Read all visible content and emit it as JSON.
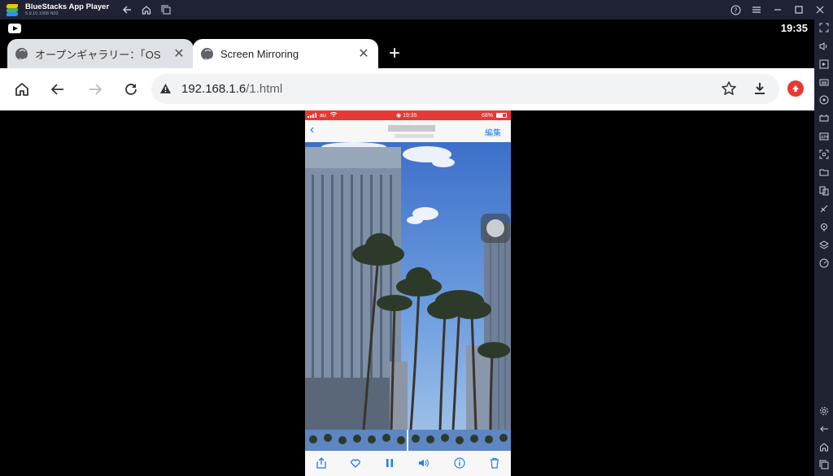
{
  "titlebar": {
    "app_name": "BlueStacks App Player",
    "version": "5.9.10.1008  N32"
  },
  "status": {
    "time": "19:35"
  },
  "tabs": [
    {
      "label": "オープンギャラリー：「OS",
      "active": false
    },
    {
      "label": "Screen Mirroring",
      "active": true
    }
  ],
  "toolbar": {
    "url_host": "192.168.1.6",
    "url_path": "/1.html"
  },
  "phone": {
    "carrier": "au",
    "time": "19:35",
    "battery": "68%",
    "edit_label": "編集"
  },
  "colors": {
    "titlebar_bg": "#1e2233",
    "ios_status_red": "#e53935",
    "ios_blue": "#1a7cf4",
    "update_badge": "#e53935"
  }
}
